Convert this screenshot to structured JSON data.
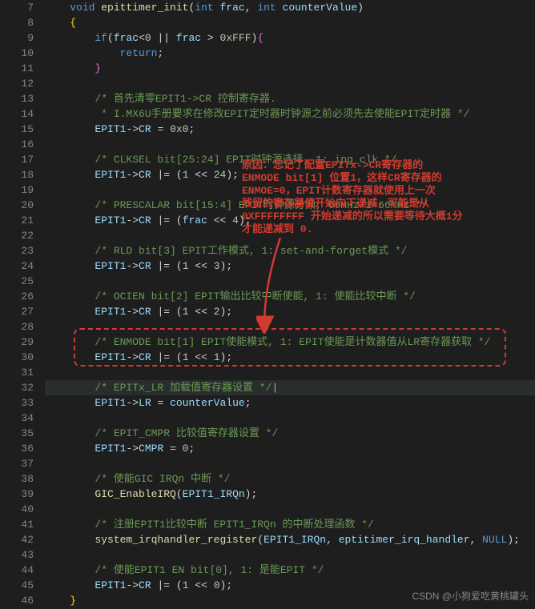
{
  "lines": [
    {
      "n": "7",
      "indent": 0,
      "tokens": [
        [
          "kw",
          "void "
        ],
        [
          "fn",
          "epittimer_init"
        ],
        [
          "punc",
          "("
        ],
        [
          "type",
          "int "
        ],
        [
          "param",
          "frac"
        ],
        [
          "punc",
          ", "
        ],
        [
          "type",
          "int "
        ],
        [
          "param",
          "counterValue"
        ],
        [
          "punc",
          ")"
        ]
      ]
    },
    {
      "n": "8",
      "indent": 0,
      "tokens": [
        [
          "brace",
          "{"
        ]
      ]
    },
    {
      "n": "9",
      "indent": 2,
      "tokens": [
        [
          "kw",
          "if"
        ],
        [
          "punc",
          "("
        ],
        [
          "param",
          "frac"
        ],
        [
          "op",
          "<"
        ],
        [
          "num",
          "0"
        ],
        [
          "op",
          " || "
        ],
        [
          "param",
          "frac"
        ],
        [
          "op",
          " > "
        ],
        [
          "num",
          "0xFFF"
        ],
        [
          "punc",
          ")"
        ],
        [
          "brace2",
          "{"
        ]
      ]
    },
    {
      "n": "10",
      "indent": 4,
      "tokens": [
        [
          "kw",
          "return"
        ],
        [
          "punc",
          ";"
        ]
      ]
    },
    {
      "n": "11",
      "indent": 2,
      "tokens": [
        [
          "brace2",
          "}"
        ]
      ]
    },
    {
      "n": "12",
      "indent": 0,
      "tokens": []
    },
    {
      "n": "13",
      "indent": 2,
      "tokens": [
        [
          "comment",
          "/* 首先清零EPIT1->CR 控制寄存器."
        ]
      ]
    },
    {
      "n": "14",
      "indent": 2,
      "tokens": [
        [
          "comment",
          " * I.MX6U手册要求在修改EPIT定时器时钟源之前必须先去使能EPIT定时器 */"
        ]
      ]
    },
    {
      "n": "15",
      "indent": 2,
      "tokens": [
        [
          "param",
          "EPIT1"
        ],
        [
          "op",
          "->"
        ],
        [
          "param",
          "CR"
        ],
        [
          "op",
          " = "
        ],
        [
          "num",
          "0x0"
        ],
        [
          "punc",
          ";"
        ]
      ]
    },
    {
      "n": "16",
      "indent": 0,
      "tokens": []
    },
    {
      "n": "17",
      "indent": 2,
      "tokens": [
        [
          "comment",
          "/* CLKSEL bit[25:24] EPIT时钟源选择, 1: ipg_clk */"
        ]
      ]
    },
    {
      "n": "18",
      "indent": 2,
      "tokens": [
        [
          "param",
          "EPIT1"
        ],
        [
          "op",
          "->"
        ],
        [
          "param",
          "CR"
        ],
        [
          "op",
          " |= "
        ],
        [
          "punc",
          "("
        ],
        [
          "num",
          "1"
        ],
        [
          "op",
          " << "
        ],
        [
          "num",
          "24"
        ],
        [
          "punc",
          ");"
        ]
      ]
    },
    {
      "n": "19",
      "indent": 0,
      "tokens": []
    },
    {
      "n": "20",
      "indent": 2,
      "tokens": [
        [
          "comment",
          "/* PRESCALAR bit[15:4] EPIT时钟源分频, 66MHz/1=66MHz */"
        ]
      ]
    },
    {
      "n": "21",
      "indent": 2,
      "tokens": [
        [
          "param",
          "EPIT1"
        ],
        [
          "op",
          "->"
        ],
        [
          "param",
          "CR"
        ],
        [
          "op",
          " |= "
        ],
        [
          "punc",
          "("
        ],
        [
          "param",
          "frac"
        ],
        [
          "op",
          " << "
        ],
        [
          "num",
          "4"
        ],
        [
          "punc",
          ");"
        ]
      ]
    },
    {
      "n": "22",
      "indent": 0,
      "tokens": []
    },
    {
      "n": "23",
      "indent": 2,
      "tokens": [
        [
          "comment",
          "/* RLD bit[3] EPIT工作模式, 1: set-and-forget模式 */"
        ]
      ]
    },
    {
      "n": "24",
      "indent": 2,
      "tokens": [
        [
          "param",
          "EPIT1"
        ],
        [
          "op",
          "->"
        ],
        [
          "param",
          "CR"
        ],
        [
          "op",
          " |= "
        ],
        [
          "punc",
          "("
        ],
        [
          "num",
          "1"
        ],
        [
          "op",
          " << "
        ],
        [
          "num",
          "3"
        ],
        [
          "punc",
          ");"
        ]
      ]
    },
    {
      "n": "25",
      "indent": 0,
      "tokens": []
    },
    {
      "n": "26",
      "indent": 2,
      "tokens": [
        [
          "comment",
          "/* OCIEN bit[2] EPIT输出比较中断使能, 1: 使能比较中断 */"
        ]
      ]
    },
    {
      "n": "27",
      "indent": 2,
      "tokens": [
        [
          "param",
          "EPIT1"
        ],
        [
          "op",
          "->"
        ],
        [
          "param",
          "CR"
        ],
        [
          "op",
          " |= "
        ],
        [
          "punc",
          "("
        ],
        [
          "num",
          "1"
        ],
        [
          "op",
          " << "
        ],
        [
          "num",
          "2"
        ],
        [
          "punc",
          ");"
        ]
      ]
    },
    {
      "n": "28",
      "indent": 0,
      "tokens": []
    },
    {
      "n": "29",
      "indent": 2,
      "tokens": [
        [
          "comment",
          "/* ENMODE bit[1] EPIT使能模式, 1: EPIT使能是计数器值从LR寄存器获取 */"
        ]
      ]
    },
    {
      "n": "30",
      "indent": 2,
      "tokens": [
        [
          "param",
          "EPIT1"
        ],
        [
          "op",
          "->"
        ],
        [
          "param",
          "CR"
        ],
        [
          "op",
          " |= "
        ],
        [
          "punc",
          "("
        ],
        [
          "num",
          "1"
        ],
        [
          "op",
          " << "
        ],
        [
          "num",
          "1"
        ],
        [
          "punc",
          ");"
        ]
      ]
    },
    {
      "n": "31",
      "indent": 0,
      "tokens": []
    },
    {
      "n": "32",
      "indent": 2,
      "hl": true,
      "tokens": [
        [
          "comment",
          "/* EPITx_LR 加载值寄存器设置 */"
        ]
      ],
      "cursor": true
    },
    {
      "n": "33",
      "indent": 2,
      "tokens": [
        [
          "param",
          "EPIT1"
        ],
        [
          "op",
          "->"
        ],
        [
          "param",
          "LR"
        ],
        [
          "op",
          " = "
        ],
        [
          "param",
          "counterValue"
        ],
        [
          "punc",
          ";"
        ]
      ]
    },
    {
      "n": "34",
      "indent": 0,
      "tokens": []
    },
    {
      "n": "35",
      "indent": 2,
      "tokens": [
        [
          "comment",
          "/* EPIT_CMPR 比较值寄存器设置 */"
        ]
      ]
    },
    {
      "n": "36",
      "indent": 2,
      "tokens": [
        [
          "param",
          "EPIT1"
        ],
        [
          "op",
          "->"
        ],
        [
          "param",
          "CMPR"
        ],
        [
          "op",
          " = "
        ],
        [
          "num",
          "0"
        ],
        [
          "punc",
          ";"
        ]
      ]
    },
    {
      "n": "37",
      "indent": 0,
      "tokens": []
    },
    {
      "n": "38",
      "indent": 2,
      "tokens": [
        [
          "comment",
          "/* 使能GIC IRQn 中断 */"
        ]
      ]
    },
    {
      "n": "39",
      "indent": 2,
      "tokens": [
        [
          "fn",
          "GIC_EnableIRQ"
        ],
        [
          "punc",
          "("
        ],
        [
          "param",
          "EPIT1_IRQn"
        ],
        [
          "punc",
          ");"
        ]
      ]
    },
    {
      "n": "40",
      "indent": 0,
      "tokens": []
    },
    {
      "n": "41",
      "indent": 2,
      "tokens": [
        [
          "comment",
          "/* 注册EPIT1比较中断 EPIT1_IRQn 的中断处理函数 */"
        ]
      ]
    },
    {
      "n": "42",
      "indent": 2,
      "tokens": [
        [
          "fn",
          "system_irqhandler_register"
        ],
        [
          "punc",
          "("
        ],
        [
          "param",
          "EPIT1_IRQn"
        ],
        [
          "punc",
          ", "
        ],
        [
          "param",
          "eptitimer_irq_handler"
        ],
        [
          "punc",
          ", "
        ],
        [
          "null",
          "NULL"
        ],
        [
          "punc",
          ");"
        ]
      ]
    },
    {
      "n": "43",
      "indent": 0,
      "tokens": []
    },
    {
      "n": "44",
      "indent": 2,
      "tokens": [
        [
          "comment",
          "/* 使能EPIT1 EN bit[0], 1: 是能EPIT */"
        ]
      ]
    },
    {
      "n": "45",
      "indent": 2,
      "tokens": [
        [
          "param",
          "EPIT1"
        ],
        [
          "op",
          "->"
        ],
        [
          "param",
          "CR"
        ],
        [
          "op",
          " |= "
        ],
        [
          "punc",
          "("
        ],
        [
          "num",
          "1"
        ],
        [
          "op",
          " << "
        ],
        [
          "num",
          "0"
        ],
        [
          "punc",
          ");"
        ]
      ]
    },
    {
      "n": "46",
      "indent": 0,
      "tokens": [
        [
          "brace",
          "}"
        ]
      ]
    }
  ],
  "annotation": "原因：忘记了配置EPITx->CR寄存器的\nENMODE bit[1] 位置1，这样CR寄存器的\nENMOE=0，EPIT计数寄存器就使用上一次\n残留的寄存器值开始向下递减，可能是从\n0XFFFFFFFF 开始递减的所以需要等待大概1分\n才能递减到 0.",
  "watermark": "CSDN @小狗爱吃黄桃罐头"
}
